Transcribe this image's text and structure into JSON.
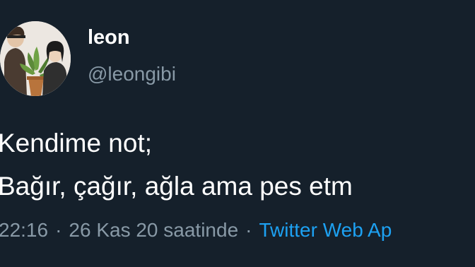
{
  "tweet": {
    "author": {
      "display_name": "leon",
      "handle": "@leongibi",
      "avatar_icon": "avatar-illustration-couple-with-plant"
    },
    "text_lines": [
      "Kendime not;",
      "Bağır, çağır, ağla ama pes etm"
    ],
    "meta": {
      "time": "22:16",
      "separator": "·",
      "date": "26 Kas 20 saatinde",
      "source": "Twitter Web Ap"
    }
  },
  "colors": {
    "background": "#15202b",
    "text_primary": "#ffffff",
    "text_secondary": "#8899a6",
    "link": "#1da1f2"
  }
}
